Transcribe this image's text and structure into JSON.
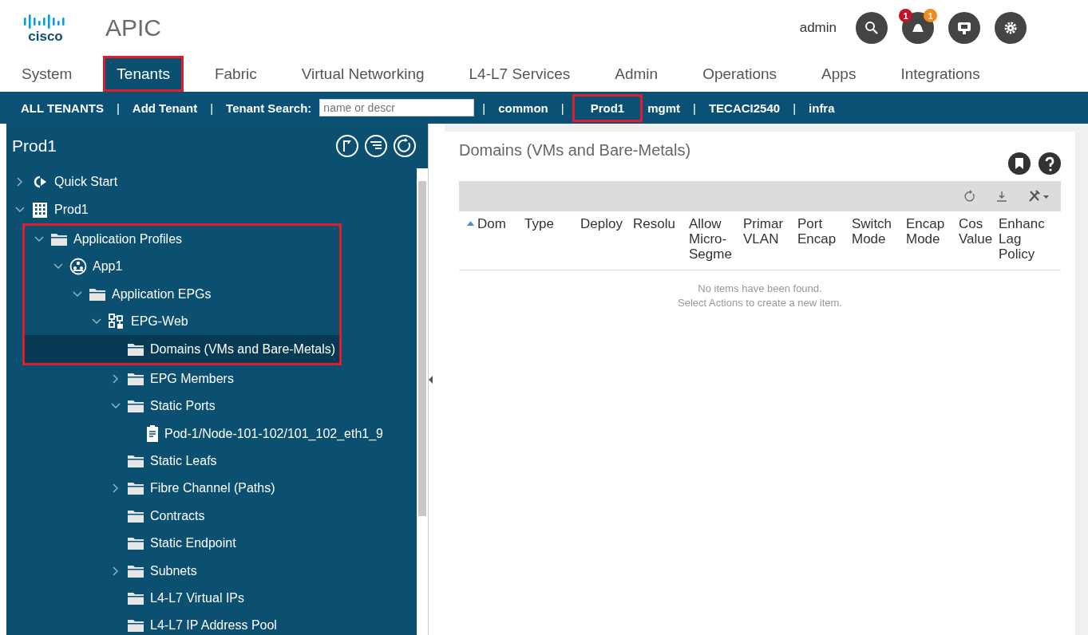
{
  "header": {
    "logo_text": "cisco",
    "product": "APIC",
    "user": "admin",
    "alerts": [
      "1",
      "1"
    ]
  },
  "tabs": [
    {
      "label": "System",
      "selected": false,
      "highlighted": false
    },
    {
      "label": "Tenants",
      "selected": true,
      "highlighted": true
    },
    {
      "label": "Fabric",
      "selected": false,
      "highlighted": false
    },
    {
      "label": "Virtual Networking",
      "selected": false,
      "highlighted": false
    },
    {
      "label": "L4-L7 Services",
      "selected": false,
      "highlighted": false
    },
    {
      "label": "Admin",
      "selected": false,
      "highlighted": false
    },
    {
      "label": "Operations",
      "selected": false,
      "highlighted": false
    },
    {
      "label": "Apps",
      "selected": false,
      "highlighted": false
    },
    {
      "label": "Integrations",
      "selected": false,
      "highlighted": false
    }
  ],
  "subnav": {
    "items": [
      {
        "kind": "link",
        "label": "ALL TENANTS"
      },
      {
        "kind": "separator",
        "label": "|"
      },
      {
        "kind": "link",
        "label": "Add Tenant"
      },
      {
        "kind": "separator",
        "label": "|"
      },
      {
        "kind": "search",
        "label": "Tenant Search:",
        "placeholder": "name or descr"
      },
      {
        "kind": "separator",
        "label": "|"
      },
      {
        "kind": "link",
        "label": "common",
        "highlighted": false
      },
      {
        "kind": "separator",
        "label": "|"
      },
      {
        "kind": "link",
        "label": "Prod1",
        "highlighted": true
      },
      {
        "kind": "link",
        "label": "mgmt",
        "highlighted": false
      },
      {
        "kind": "separator",
        "label": "|"
      },
      {
        "kind": "link",
        "label": "TECACI2540",
        "highlighted": false
      },
      {
        "kind": "separator",
        "label": "|"
      },
      {
        "kind": "link",
        "label": "infra",
        "highlighted": false
      }
    ]
  },
  "sidebar": {
    "title": "Prod1",
    "tree": [
      {
        "label": "Quick Start",
        "kind": "start",
        "expanded": false,
        "selected": false,
        "highlighted": false
      },
      {
        "label": "Prod1",
        "kind": "tenant",
        "expanded": true,
        "selected": false,
        "highlighted": false,
        "children": [
          {
            "label": "Application Profiles",
            "kind": "folder",
            "expanded": true,
            "selected": false,
            "highlighted": true,
            "children": [
              {
                "label": "App1",
                "kind": "app",
                "expanded": true,
                "selected": false,
                "highlighted": true,
                "children": [
                  {
                    "label": "Application EPGs",
                    "kind": "folder",
                    "expanded": true,
                    "selected": false,
                    "highlighted": true,
                    "children": [
                      {
                        "label": "EPG-Web",
                        "kind": "epg",
                        "expanded": true,
                        "selected": false,
                        "highlighted": true,
                        "children": [
                          {
                            "label": "Domains (VMs and Bare-Metals)",
                            "kind": "folder",
                            "selected": true,
                            "highlighted": true
                          },
                          {
                            "label": "EPG Members",
                            "kind": "folder",
                            "expanded": false,
                            "selected": false,
                            "highlighted": false
                          },
                          {
                            "label": "Static Ports",
                            "kind": "folder",
                            "expanded": true,
                            "selected": false,
                            "highlighted": false,
                            "children": [
                              {
                                "label": "Pod-1/Node-101-102/101_102_eth1_9",
                                "kind": "port",
                                "selected": false,
                                "highlighted": false
                              }
                            ]
                          },
                          {
                            "label": "Static Leafs",
                            "kind": "folder",
                            "selected": false,
                            "highlighted": false
                          },
                          {
                            "label": "Fibre Channel (Paths)",
                            "kind": "folder",
                            "expanded": false,
                            "selected": false,
                            "highlighted": false
                          },
                          {
                            "label": "Contracts",
                            "kind": "folder",
                            "selected": false,
                            "highlighted": false
                          },
                          {
                            "label": "Static Endpoint",
                            "kind": "folder",
                            "selected": false,
                            "highlighted": false
                          },
                          {
                            "label": "Subnets",
                            "kind": "folder",
                            "expanded": false,
                            "selected": false,
                            "highlighted": false
                          },
                          {
                            "label": "L4-L7 Virtual IPs",
                            "kind": "folder",
                            "selected": false,
                            "highlighted": false
                          },
                          {
                            "label": "L4-L7 IP Address Pool",
                            "kind": "folder",
                            "selected": false,
                            "highlighted": false
                          }
                        ]
                      }
                    ]
                  }
                ]
              }
            ]
          }
        ]
      }
    ]
  },
  "content": {
    "title": "Domains (VMs and Bare-Metals)",
    "table": {
      "columns": [
        [
          "Dom"
        ],
        [
          "Type"
        ],
        [
          "Deploy"
        ],
        [
          "Resolu"
        ],
        [
          "Allow",
          "Micro-",
          "Segme"
        ],
        [
          "Primar",
          "VLAN"
        ],
        [
          "Port",
          "Encap"
        ],
        [
          "Switch",
          "Mode"
        ],
        [
          "Encap",
          "Mode"
        ],
        [
          "Cos",
          "Value"
        ],
        [
          "Enhanc",
          "Lag",
          "Policy"
        ]
      ],
      "empty_message": [
        "No items have been found.",
        "Select Actions to create a new item."
      ]
    }
  }
}
